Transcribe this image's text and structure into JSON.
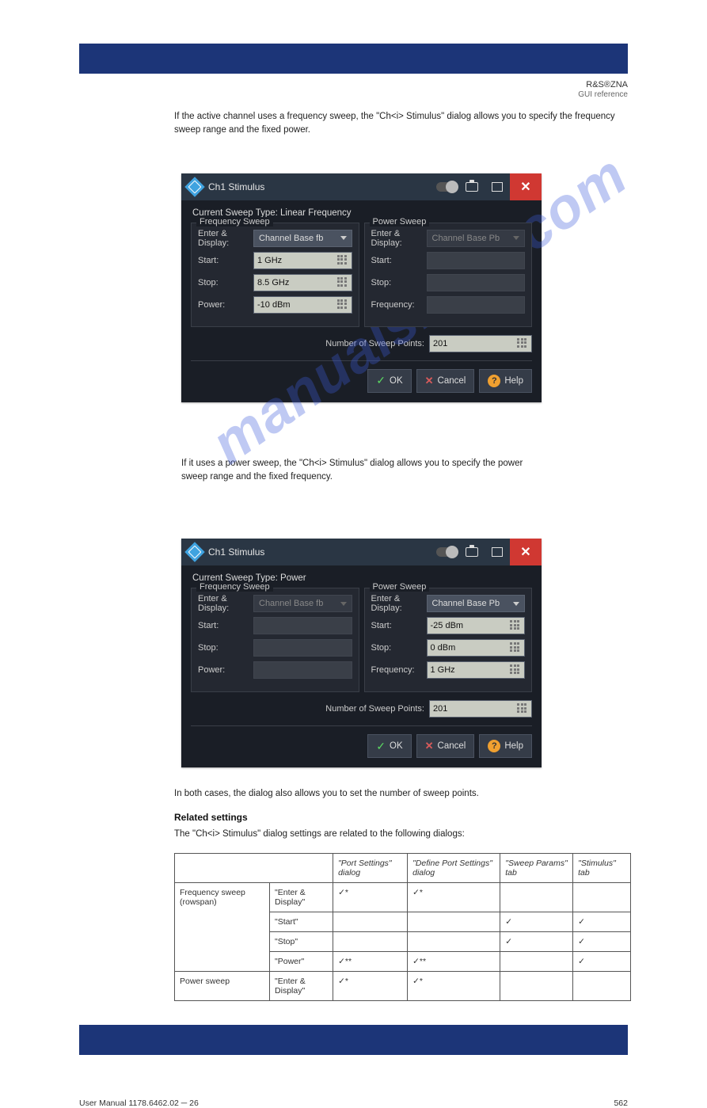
{
  "header": {
    "brand": "R&S®ZNA",
    "section": "GUI reference"
  },
  "intro_text": "If the active channel uses a frequency sweep, the \"Ch<i> Stimulus\" dialog allows you to specify the frequency sweep range and the fixed power.",
  "dialog1": {
    "title": "Ch1 Stimulus",
    "sweep_type_label": "Current Sweep Type:",
    "sweep_type_value": "Linear Frequency",
    "freq_panel_title": "Frequency Sweep",
    "power_panel_title": "Power Sweep",
    "enter_display_label": "Enter & Display:",
    "freq_enter_display": "Channel Base fb",
    "power_enter_display": "Channel Base Pb",
    "labels": {
      "start": "Start:",
      "stop": "Stop:",
      "power": "Power:",
      "frequency": "Frequency:"
    },
    "freq_start": "1 GHz",
    "freq_stop": "8.5 GHz",
    "freq_power": "-10 dBm",
    "points_label": "Number of Sweep Points:",
    "points_value": "201",
    "ok": "OK",
    "cancel": "Cancel",
    "help": "Help"
  },
  "mid_text": "If it uses a power sweep, the \"Ch<i> Stimulus\" dialog allows you to specify the power sweep range and the fixed frequency.",
  "dialog2": {
    "title": "Ch1 Stimulus",
    "sweep_type_label": "Current Sweep Type:",
    "sweep_type_value": "Power",
    "freq_panel_title": "Frequency Sweep",
    "power_panel_title": "Power Sweep",
    "enter_display_label": "Enter & Display:",
    "freq_enter_display": "Channel Base fb",
    "power_enter_display": "Channel Base Pb",
    "labels": {
      "start": "Start:",
      "stop": "Stop:",
      "power": "Power:",
      "frequency": "Frequency:"
    },
    "pw_start": "-25 dBm",
    "pw_stop": "0 dBm",
    "pw_frequency": "1 GHz",
    "points_label": "Number of Sweep Points:",
    "points_value": "201",
    "ok": "OK",
    "cancel": "Cancel",
    "help": "Help"
  },
  "aftertext": "In both cases, the dialog also allows you to set the number of sweep points.",
  "related_heading": "Related settings",
  "table_intro": "The \"Ch<i> Stimulus\" dialog settings are related to the following dialogs:",
  "table": {
    "cols": [
      "",
      "",
      "\"Port Settings\" dialog",
      "\"Define Port Settings\" dialog",
      "\"Sweep Params\" tab",
      "\"Stimulus\" tab"
    ],
    "rows": [
      [
        "Frequency sweep (rowspan)",
        "\"Enter & Display\"",
        "✓*",
        "✓*",
        "",
        ""
      ],
      [
        "",
        "\"Start\"",
        "",
        "",
        "✓",
        "✓"
      ],
      [
        "",
        "\"Stop\"",
        "",
        "",
        "✓",
        "✓"
      ],
      [
        "",
        "\"Power\"",
        "✓**",
        "✓**",
        "",
        "✓"
      ],
      [
        "Power sweep",
        "\"Enter & Display\"",
        "✓*",
        "✓*",
        "",
        ""
      ]
    ]
  },
  "footer": {
    "left": "User Manual 1178.6462.02 ─ 26",
    "right": "562"
  },
  "watermark": "manualshive.com"
}
